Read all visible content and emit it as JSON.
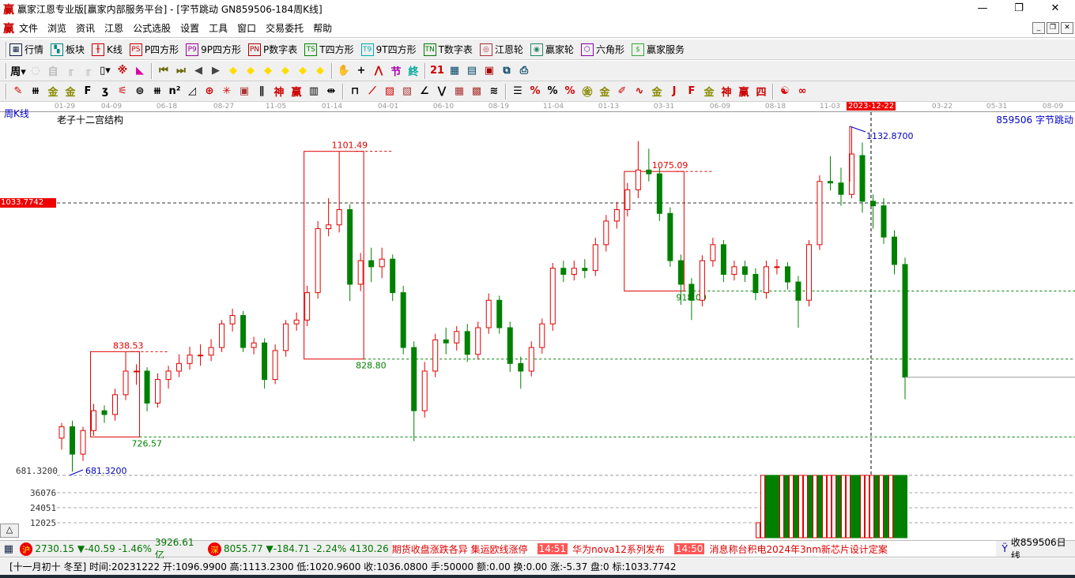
{
  "title": "赢家江恩专业版[赢家内部服务平台] - [字节跳动  GN859506-184周K线]",
  "logo": "赢",
  "window_controls": {
    "minimize": "—",
    "restore": "❐",
    "close": "✕"
  },
  "menu": [
    "文件",
    "浏览",
    "资讯",
    "江恩",
    "公式选股",
    "设置",
    "工具",
    "窗口",
    "交易委托",
    "帮助"
  ],
  "mdi_controls": [
    "_",
    "❐",
    "✕"
  ],
  "toolbar1": [
    {
      "icon": "grid-icon",
      "glyph": "▦",
      "color": "#124",
      "label": "行情"
    },
    {
      "icon": "blocks-icon",
      "glyph": "▚",
      "color": "#088",
      "label": "板块"
    },
    {
      "icon": "kline-icon",
      "glyph": "╫",
      "color": "#c00",
      "label": "K线"
    },
    {
      "icon": "ps-icon",
      "glyph": "PS",
      "color": "#c00",
      "label": "P四方形"
    },
    {
      "icon": "p9-icon",
      "glyph": "P9",
      "color": "#909",
      "label": "9P四方形"
    },
    {
      "icon": "pn-icon",
      "glyph": "PN",
      "color": "#a00",
      "label": "P数字表"
    },
    {
      "icon": "ts-icon",
      "glyph": "TS",
      "color": "#080",
      "label": "T四方形"
    },
    {
      "icon": "t9-icon",
      "glyph": "T9",
      "color": "#0aa",
      "label": "9T四方形"
    },
    {
      "icon": "tn-icon",
      "glyph": "TN",
      "color": "#070",
      "label": "T数字表"
    },
    {
      "icon": "gann-wheel-icon",
      "glyph": "◎",
      "color": "#a33",
      "label": "江恩轮"
    },
    {
      "icon": "winner-wheel-icon",
      "glyph": "◉",
      "color": "#286",
      "label": "赢家轮"
    },
    {
      "icon": "hexagon-icon",
      "glyph": "⬡",
      "color": "#80a",
      "label": "六角形"
    },
    {
      "icon": "dollar-icon",
      "glyph": "$",
      "color": "#3a3",
      "label": "赢家服务"
    }
  ],
  "toolbar2": [
    {
      "icon": "period-week-icon",
      "glyph": "周▾",
      "color": "#000"
    },
    {
      "icon": "disabled-icon",
      "glyph": "◌",
      "color": "#bbb"
    },
    {
      "icon": "self-icon",
      "glyph": "自",
      "color": "#bbb"
    },
    {
      "icon": "bars3-icon",
      "glyph": "╓",
      "color": "#bbb"
    },
    {
      "icon": "bars9-icon",
      "glyph": "╓",
      "color": "#bbb"
    },
    {
      "icon": "candle-type-icon",
      "glyph": "▯▾",
      "color": "#000"
    },
    {
      "icon": "formula-icon",
      "glyph": "※",
      "color": "#c00"
    },
    {
      "icon": "volume-profile-icon",
      "glyph": "◣",
      "color": "#d0a"
    },
    {
      "sep": true
    },
    {
      "icon": "first-icon",
      "glyph": "⏮",
      "color": "#660"
    },
    {
      "icon": "last-icon",
      "glyph": "⏭",
      "color": "#660"
    },
    {
      "icon": "left-icon",
      "glyph": "◀",
      "color": "#444"
    },
    {
      "icon": "right-icon",
      "glyph": "▶",
      "color": "#444"
    },
    {
      "icon": "arrow-left-diamond-icon",
      "glyph": "◆",
      "color": "#fd0"
    },
    {
      "icon": "arrow-right-diamond-icon",
      "glyph": "◆",
      "color": "#fd0"
    },
    {
      "icon": "expand-h-diamond-icon",
      "glyph": "◆",
      "color": "#fd0"
    },
    {
      "icon": "shrink-diamond-icon",
      "glyph": "◆",
      "color": "#fd0"
    },
    {
      "icon": "expand-v-diamond-icon",
      "glyph": "◆",
      "color": "#fd0"
    },
    {
      "icon": "expand-all-diamond-icon",
      "glyph": "◆",
      "color": "#fd0"
    },
    {
      "sep": true
    },
    {
      "icon": "hand-icon",
      "glyph": "✋",
      "color": "#000"
    },
    {
      "icon": "crosshair-icon",
      "glyph": "+",
      "color": "#000"
    },
    {
      "icon": "line-tool-icon",
      "glyph": "⋀",
      "color": "#c00"
    },
    {
      "icon": "section-icon",
      "glyph": "节",
      "color": "#a0a"
    },
    {
      "icon": "pattern-icon",
      "glyph": "終",
      "color": "#0a9"
    },
    {
      "sep": true
    },
    {
      "icon": "calendar-icon",
      "glyph": "21",
      "color": "#c00"
    },
    {
      "icon": "calculator-icon",
      "glyph": "▦",
      "color": "#046"
    },
    {
      "icon": "report-icon",
      "glyph": "▤",
      "color": "#046"
    },
    {
      "icon": "save-icon",
      "glyph": "▣",
      "color": "#a00"
    },
    {
      "icon": "network-icon",
      "glyph": "⧉",
      "color": "#046"
    },
    {
      "icon": "print-icon",
      "glyph": "⎙",
      "color": "#046"
    }
  ],
  "toolbar3": [
    {
      "icon": "pen-icon",
      "glyph": "✎",
      "color": "#c00"
    },
    {
      "icon": "hash-icon",
      "glyph": "⧻",
      "color": "#000"
    },
    {
      "icon": "gold1-icon",
      "glyph": "金",
      "color": "#880"
    },
    {
      "icon": "gold2-icon",
      "glyph": "金",
      "color": "#880"
    },
    {
      "icon": "fib-icon",
      "glyph": "F",
      "color": "#000"
    },
    {
      "icon": "spiral-icon",
      "glyph": "ʒ",
      "color": "#000"
    },
    {
      "icon": "fan-icon",
      "glyph": "⚟",
      "color": "#c00"
    },
    {
      "icon": "circle-icon",
      "glyph": "⊜",
      "color": "#000"
    },
    {
      "icon": "lines-icon",
      "glyph": "⧻",
      "color": "#000"
    },
    {
      "icon": "n2-icon",
      "glyph": "n²",
      "color": "#000"
    },
    {
      "icon": "triangle-icon",
      "glyph": "◿",
      "color": "#000"
    },
    {
      "icon": "target-icon",
      "glyph": "⊕",
      "color": "#c00"
    },
    {
      "icon": "star-icon",
      "glyph": "✳",
      "color": "#c00"
    },
    {
      "icon": "square-target-icon",
      "glyph": "▣",
      "color": "#a33"
    },
    {
      "icon": "slash-icon",
      "glyph": "∥",
      "color": "#000"
    },
    {
      "icon": "shen-icon",
      "glyph": "神",
      "color": "#c00"
    },
    {
      "icon": "ying-icon",
      "glyph": "赢",
      "color": "#c00"
    },
    {
      "icon": "grid-lines-icon",
      "glyph": "▥",
      "color": "#000"
    },
    {
      "icon": "measure-icon",
      "glyph": "⇹",
      "color": "#000"
    },
    {
      "sep": true
    },
    {
      "icon": "box-icon",
      "glyph": "⊓",
      "color": "#000"
    },
    {
      "icon": "fan-lines-icon",
      "glyph": "⟋",
      "color": "#c00"
    },
    {
      "icon": "box-fan-icon",
      "glyph": "▨",
      "color": "#c00"
    },
    {
      "icon": "box-fan2-icon",
      "glyph": "▧",
      "color": "#a33"
    },
    {
      "icon": "angle-icon",
      "glyph": "∠",
      "color": "#000"
    },
    {
      "icon": "zigzag-icon",
      "glyph": "⋁",
      "color": "#000"
    },
    {
      "icon": "grid-red-icon",
      "glyph": "▦",
      "color": "#a33"
    },
    {
      "icon": "grid-red2-icon",
      "glyph": "▩",
      "color": "#a33"
    },
    {
      "icon": "parallel-icon",
      "glyph": "≋",
      "color": "#000"
    },
    {
      "sep": true
    },
    {
      "icon": "levels-icon",
      "glyph": "☰",
      "color": "#000"
    },
    {
      "icon": "percent-red-icon",
      "glyph": "%",
      "color": "#c00"
    },
    {
      "icon": "percent-icon",
      "glyph": "%",
      "color": "#000"
    },
    {
      "icon": "percent-lines-icon",
      "glyph": "%",
      "color": "#c00"
    },
    {
      "icon": "gold-circle-icon",
      "glyph": "㊎",
      "color": "#880"
    },
    {
      "icon": "gold-lines-icon",
      "glyph": "金",
      "color": "#880"
    },
    {
      "icon": "brush-icon",
      "glyph": "✐",
      "color": "#c00"
    },
    {
      "icon": "wave-icon",
      "glyph": "∿",
      "color": "#c00"
    },
    {
      "icon": "gold-box-icon",
      "glyph": "金",
      "color": "#880"
    },
    {
      "icon": "j-angle-icon",
      "glyph": "J",
      "color": "#c00"
    },
    {
      "icon": "f-angle-icon",
      "glyph": "F",
      "color": "#c00"
    },
    {
      "icon": "gold-angle-icon",
      "glyph": "金",
      "color": "#880"
    },
    {
      "icon": "shen-angle-icon",
      "glyph": "神",
      "color": "#c00"
    },
    {
      "icon": "ying-angle-icon",
      "glyph": "赢",
      "color": "#c00"
    },
    {
      "icon": "si-angle-icon",
      "glyph": "四",
      "color": "#c00"
    },
    {
      "sep": true
    },
    {
      "icon": "yinyang-icon",
      "glyph": "☯",
      "color": "#d00"
    },
    {
      "icon": "infinity-icon",
      "glyph": "∞",
      "color": "#c00"
    }
  ],
  "date_axis": {
    "ticks": [
      "01-29",
      "04-09",
      "06-18",
      "08-27",
      "11-05",
      "01-14",
      "04-01",
      "06-10",
      "08-19",
      "11-04",
      "01-13",
      "03-31",
      "06-09",
      "08-18",
      "11-03",
      "03-22",
      "05-31",
      "08-09"
    ],
    "selected": "2023-12-22"
  },
  "chart_header": {
    "period": "周K线",
    "indicator": "老子十二宫结构",
    "stock": "859506  字节跳动"
  },
  "price_axis": {
    "current_price_tag": "1033.7742",
    "low_label": "681.3200"
  },
  "volume_axis": [
    "36076",
    "24051",
    "12025"
  ],
  "scroll_button": "△",
  "chart_data": {
    "type": "candlestick",
    "title": "字节跳动 GN859506 周K线",
    "ylim": [
      640,
      1180
    ],
    "reference_price": 1033.7742,
    "high_marker": "1132.8700",
    "low_marker": "681.3200",
    "cursor_date": "2023-12-22",
    "boxes": [
      {
        "start": 3,
        "end": 7,
        "top": 838.53,
        "bottom": 726.57,
        "top_label": "838.53",
        "bottom_label": "726.57"
      },
      {
        "start": 23,
        "end": 28,
        "top": 1101.49,
        "bottom": 828.8,
        "top_label": "1101.49",
        "bottom_label": "828.80"
      },
      {
        "start": 53,
        "end": 58,
        "top": 1075.09,
        "bottom": 918.09,
        "top_label": "1075.09",
        "bottom_label": "918.09"
      }
    ],
    "ohlc": [
      [
        725,
        745,
        710,
        740
      ],
      [
        740,
        748,
        681,
        704
      ],
      [
        704,
        740,
        695,
        735
      ],
      [
        735,
        770,
        728,
        761
      ],
      [
        761,
        768,
        745,
        756
      ],
      [
        756,
        790,
        748,
        782
      ],
      [
        782,
        838,
        775,
        813
      ],
      [
        813,
        822,
        795,
        813
      ],
      [
        813,
        818,
        760,
        771
      ],
      [
        771,
        810,
        765,
        802
      ],
      [
        802,
        820,
        790,
        813
      ],
      [
        813,
        835,
        805,
        823
      ],
      [
        823,
        845,
        815,
        834
      ],
      [
        834,
        848,
        820,
        834
      ],
      [
        834,
        855,
        826,
        844
      ],
      [
        844,
        880,
        838,
        875
      ],
      [
        875,
        895,
        865,
        886
      ],
      [
        886,
        892,
        838,
        844
      ],
      [
        844,
        858,
        835,
        850
      ],
      [
        850,
        856,
        790,
        802
      ],
      [
        802,
        848,
        796,
        840
      ],
      [
        840,
        880,
        832,
        875
      ],
      [
        875,
        890,
        866,
        880
      ],
      [
        880,
        925,
        872,
        916
      ],
      [
        916,
        1010,
        908,
        1000
      ],
      [
        1000,
        1040,
        990,
        1005
      ],
      [
        1005,
        1101,
        995,
        1025
      ],
      [
        1025,
        1032,
        905,
        927
      ],
      [
        927,
        968,
        918,
        958
      ],
      [
        958,
        975,
        930,
        950
      ],
      [
        950,
        975,
        935,
        960
      ],
      [
        960,
        966,
        905,
        916
      ],
      [
        916,
        925,
        835,
        844
      ],
      [
        844,
        852,
        721,
        761
      ],
      [
        761,
        825,
        752,
        813
      ],
      [
        813,
        862,
        805,
        854
      ],
      [
        854,
        870,
        835,
        850
      ],
      [
        850,
        872,
        840,
        865
      ],
      [
        865,
        875,
        825,
        835
      ],
      [
        835,
        878,
        828,
        870
      ],
      [
        870,
        915,
        862,
        906
      ],
      [
        906,
        912,
        862,
        870
      ],
      [
        870,
        878,
        812,
        823
      ],
      [
        823,
        832,
        790,
        813
      ],
      [
        813,
        852,
        806,
        844
      ],
      [
        844,
        882,
        836,
        875
      ],
      [
        875,
        955,
        866,
        948
      ],
      [
        948,
        958,
        930,
        940
      ],
      [
        940,
        958,
        932,
        948
      ],
      [
        948,
        960,
        935,
        945
      ],
      [
        945,
        988,
        938,
        979
      ],
      [
        979,
        1018,
        970,
        1010
      ],
      [
        1010,
        1035,
        1000,
        1025
      ],
      [
        1025,
        1060,
        1016,
        1051
      ],
      [
        1051,
        1115,
        1040,
        1077
      ],
      [
        1077,
        1105,
        1062,
        1072
      ],
      [
        1072,
        1080,
        1010,
        1020
      ],
      [
        1020,
        1028,
        950,
        958
      ],
      [
        958,
        966,
        900,
        927
      ],
      [
        927,
        935,
        880,
        906
      ],
      [
        906,
        965,
        898,
        958
      ],
      [
        958,
        988,
        950,
        979
      ],
      [
        979,
        985,
        930,
        940
      ],
      [
        940,
        958,
        932,
        950
      ],
      [
        950,
        958,
        930,
        940
      ],
      [
        940,
        948,
        906,
        916
      ],
      [
        916,
        958,
        908,
        950
      ],
      [
        950,
        960,
        940,
        950
      ],
      [
        950,
        956,
        920,
        930
      ],
      [
        930,
        938,
        870,
        906
      ],
      [
        906,
        985,
        898,
        979
      ],
      [
        979,
        1070,
        972,
        1062
      ],
      [
        1062,
        1095,
        1050,
        1060
      ],
      [
        1060,
        1080,
        1030,
        1045
      ],
      [
        1045,
        1133,
        1040,
        1098
      ],
      [
        1096,
        1113,
        1021,
        1036
      ],
      [
        1036,
        1045,
        1000,
        1030
      ],
      [
        1030,
        1040,
        980,
        989
      ],
      [
        989,
        998,
        940,
        953
      ],
      [
        953,
        962,
        776,
        805
      ]
    ],
    "volume": [
      12025,
      50000,
      50000,
      50000,
      50000,
      50000,
      50000,
      50000,
      50000,
      50000,
      50000,
      50000,
      50000,
      50000,
      50000,
      50000,
      50000,
      50000,
      50000,
      50000,
      50000,
      50000,
      50000,
      50000,
      50000,
      50000,
      50000,
      50000,
      50000,
      50000,
      50000,
      50000
    ],
    "volume_up": [
      true,
      true,
      false,
      false,
      false,
      true,
      false,
      true,
      false,
      true,
      true,
      false,
      true,
      false,
      true,
      true,
      true,
      false,
      true,
      true,
      false,
      false,
      true,
      true,
      true,
      false,
      true,
      false,
      true,
      false,
      false,
      false
    ]
  },
  "colors": {
    "up": "#e00000",
    "down": "#008000",
    "box": "#e00000",
    "level": "#008000",
    "marker": "#0000c0"
  },
  "ticker": {
    "sh": {
      "badge": "沪",
      "value": "2730.15",
      "change": "▼-40.59",
      "pct": "-1.46%",
      "amount": "3926.61亿"
    },
    "sz": {
      "badge": "深",
      "value": "8055.77",
      "change": "▼-184.71",
      "pct": "-2.24%",
      "amount": "4130.26"
    },
    "news": [
      {
        "time": "",
        "text": "期货收盘涨跌各异 集运欧线涨停"
      },
      {
        "time": "14:51",
        "text": "华为nova12系列发布"
      },
      {
        "time": "14:50",
        "text": "消息称台积电2024年3nm新芯片设计定案"
      }
    ],
    "right": "收859506日线"
  },
  "status": "[十一月初十 冬至] 时间:20231222 开:1096.9900 高:1113.2300 低:1020.9600 收:1036.0800 手:50000 额:0.00 换:0.00 涨:-5.37 盘:0 标:1033.7742"
}
